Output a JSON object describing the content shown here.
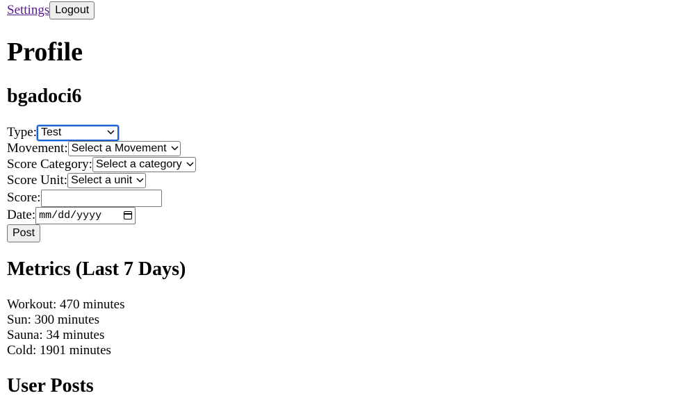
{
  "nav": {
    "settings_label": "Settings",
    "logout_label": "Logout"
  },
  "page": {
    "title": "Profile",
    "username": "bgadoci6"
  },
  "form": {
    "type": {
      "label": "Type:",
      "value": "Test"
    },
    "movement": {
      "label": "Movement:",
      "value": "Select a Movement"
    },
    "score_category": {
      "label": "Score Category:",
      "value": "Select a category"
    },
    "score_unit": {
      "label": "Score Unit:",
      "value": "Select a unit"
    },
    "score": {
      "label": "Score:",
      "value": ""
    },
    "date": {
      "label": "Date:",
      "placeholder": "mm/dd/yyyy"
    },
    "post_label": "Post"
  },
  "metrics": {
    "heading": "Metrics (Last 7 Days)",
    "items": [
      "Workout: 470 minutes",
      "Sun: 300 minutes",
      "Sauna: 34 minutes",
      "Cold: 1901 minutes"
    ]
  },
  "posts": {
    "heading": "User Posts"
  },
  "colors": {
    "link_visited": "#551a8b",
    "focus_ring": "#1a5fd6"
  },
  "icons": {
    "select_arrow": "chevron-down-icon",
    "date_picker": "calendar-icon"
  }
}
